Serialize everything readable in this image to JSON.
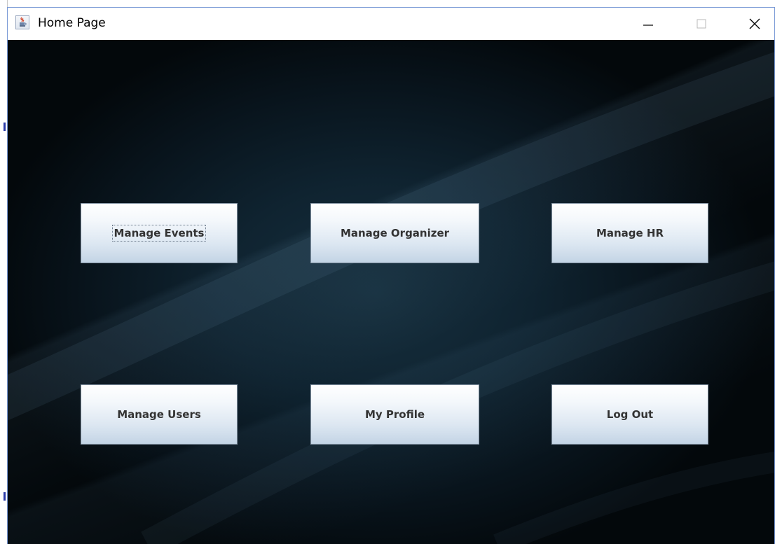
{
  "window": {
    "title": "Home Page",
    "icon": "java-coffee-cup-icon"
  },
  "title_controls": {
    "minimize_icon": "minimize-icon",
    "maximize_icon": "maximize-icon",
    "close_icon": "close-icon"
  },
  "menu": {
    "buttons": [
      {
        "label": "Manage Events",
        "focused": true
      },
      {
        "label": "Manage Organizer"
      },
      {
        "label": "Manage HR"
      },
      {
        "label": "Manage Users"
      },
      {
        "label": "My Profile"
      },
      {
        "label": "Log Out"
      }
    ]
  },
  "colors": {
    "background_center": "#17303f",
    "background_edge": "#03080b",
    "button_top": "#ffffff",
    "button_bottom": "#c3d4e5",
    "button_text": "#333333"
  }
}
